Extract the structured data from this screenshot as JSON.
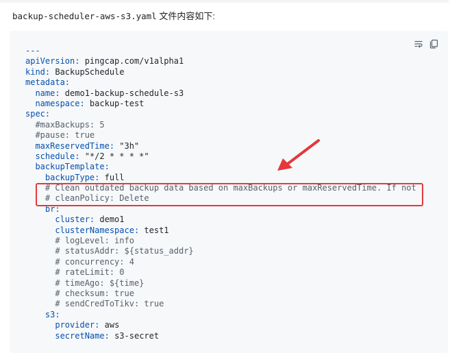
{
  "intro": {
    "filename": "backup-scheduler-aws-s3.yaml",
    "suffix": " 文件内容如下:"
  },
  "toolbar": {
    "wrap_icon": "wrap-lines-icon",
    "copy_icon": "copy-icon"
  },
  "colors": {
    "key": "#0550ae",
    "value": "#1f2328",
    "comment": "#57606a",
    "highlight": "#e4383c",
    "background": "#f6f8fa"
  },
  "code_lines": [
    {
      "indent": "",
      "key": "---",
      "value": ""
    },
    {
      "indent": "",
      "key": "apiVersion:",
      "value": " pingcap.com/v1alpha1"
    },
    {
      "indent": "",
      "key": "kind:",
      "value": " BackupSchedule"
    },
    {
      "indent": "",
      "key": "metadata:",
      "value": ""
    },
    {
      "indent": "  ",
      "key": "name:",
      "value": " demo1-backup-schedule-s3"
    },
    {
      "indent": "  ",
      "key": "namespace:",
      "value": " backup-test"
    },
    {
      "indent": "",
      "key": "spec:",
      "value": ""
    },
    {
      "indent": "  ",
      "comment": "#maxBackups: 5"
    },
    {
      "indent": "  ",
      "comment": "#pause: true"
    },
    {
      "indent": "  ",
      "key": "maxReservedTime:",
      "value": " \"3h\""
    },
    {
      "indent": "  ",
      "key": "schedule:",
      "value": " \"*/2 * * * *\""
    },
    {
      "indent": "  ",
      "key": "backupTemplate:",
      "value": ""
    },
    {
      "indent": "    ",
      "key": "backupType:",
      "value": " full"
    },
    {
      "indent": "    ",
      "comment": "# Clean outdated backup data based on maxBackups or maxReservedTime. If not configured, the default policy is Retain"
    },
    {
      "indent": "    ",
      "comment": "# cleanPolicy: Delete"
    },
    {
      "indent": "    ",
      "key": "br:",
      "value": ""
    },
    {
      "indent": "      ",
      "key": "cluster:",
      "value": " demo1"
    },
    {
      "indent": "      ",
      "key": "clusterNamespace:",
      "value": " test1"
    },
    {
      "indent": "      ",
      "comment": "# logLevel: info"
    },
    {
      "indent": "      ",
      "comment": "# statusAddr: ${status_addr}"
    },
    {
      "indent": "      ",
      "comment": "# concurrency: 4"
    },
    {
      "indent": "      ",
      "comment": "# rateLimit: 0"
    },
    {
      "indent": "      ",
      "comment": "# timeAgo: ${time}"
    },
    {
      "indent": "      ",
      "comment": "# checksum: true"
    },
    {
      "indent": "      ",
      "comment": "# sendCredToTikv: true"
    },
    {
      "indent": "    ",
      "key": "s3:",
      "value": ""
    },
    {
      "indent": "      ",
      "key": "provider:",
      "value": " aws"
    },
    {
      "indent": "      ",
      "key": "secretName:",
      "value": " s3-secret"
    }
  ]
}
